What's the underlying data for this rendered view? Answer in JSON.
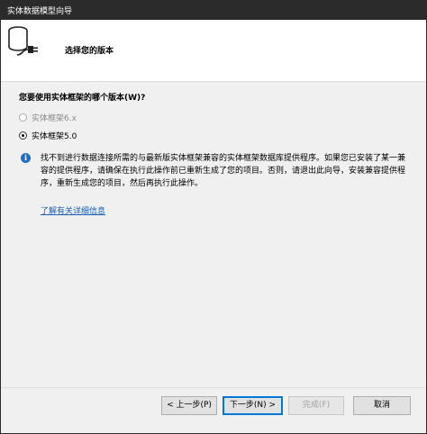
{
  "window": {
    "title": "实体数据模型向导"
  },
  "header": {
    "title": "选择您的版本",
    "icon": "database-connector-icon"
  },
  "question": "您要使用实体框架的哪个版本(W)?",
  "options": [
    {
      "label": "实体框架6.x",
      "disabled": true,
      "checked": false
    },
    {
      "label": "实体框架5.0",
      "disabled": false,
      "checked": true
    }
  ],
  "info": {
    "icon": "info-icon",
    "text": "找不到进行数据连接所需的与最新版实体框架兼容的实体框架数据库提供程序。如果您已安装了某一兼容的提供程序，请确保在执行此操作前已重新生成了您的项目。否则，请退出此向导，安装兼容提供程序，重新生成您的项目，然后再执行此操作。",
    "link": "了解有关详细信息"
  },
  "buttons": {
    "back": "< 上一步(P)",
    "next": "下一步(N) >",
    "finish": "完成(F)",
    "cancel": "取消"
  },
  "colors": {
    "accent": "#0078d7",
    "link": "#1a5fb4",
    "info": "#1e6fc4"
  }
}
